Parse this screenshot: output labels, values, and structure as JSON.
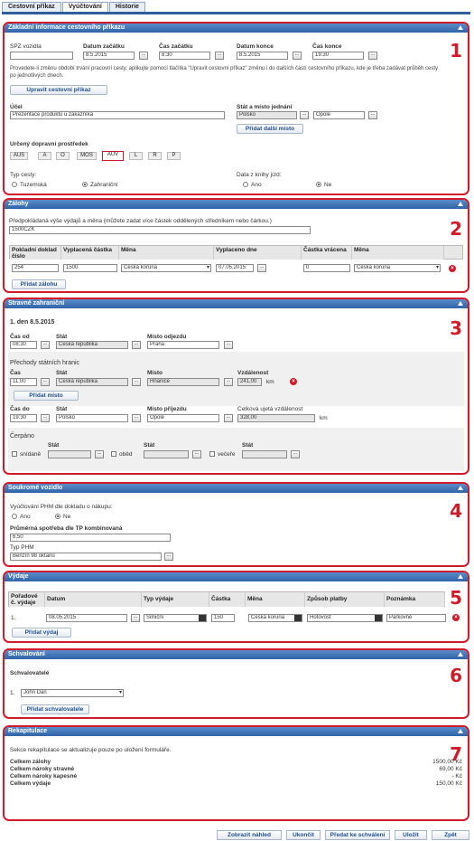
{
  "tabs": [
    "Cestovní příkaz",
    "Vyúčtování",
    "Historie"
  ],
  "s1": {
    "title": "Základní informace cestovního příkazu",
    "num": "1",
    "spz": "SPZ vozidla",
    "datum_zacatku": "Datum začátku",
    "cas_zacatku": "Čas začátku",
    "datum_konce": "Datum konce",
    "cas_konce": "Čas konce",
    "v_datum_zacatku": "8.5.2015",
    "v_cas_zacatku": "8:30",
    "v_datum_konce": "8.5.2015",
    "v_cas_konce": "19:30",
    "note": "Provedete-li změnu období trvání pracovní cesty, aplikujte pomocí tlačítka \"Upravit cestovní příkaz\" změnu i do dalších částí cestovního příkazu, kde je třeba zadávat průběh cesty po jednotlivých dnech.",
    "upravit": "Upravit cestovní příkaz",
    "ucel": "Účel",
    "v_ucel": "Prezentace produktu u zákazníka",
    "stat_misto": "Stát a místo jednání",
    "v_stat": "Polsko",
    "v_misto": "Opole",
    "pridat_misto": "Přidat další místo",
    "dopravni": "Určený dopravní prostředek",
    "transport": [
      "AUS",
      "A",
      "O",
      "MOS",
      "AUV",
      "L",
      "R",
      "P"
    ],
    "typ_cesty": "Typ cesty:",
    "tuzemska": "Tuzemská",
    "zahranicni": "Zahraniční",
    "data_kniha": "Data z knihy jízd:",
    "ano": "Ano",
    "ne": "Ne"
  },
  "s2": {
    "title": "Zálohy",
    "num": "2",
    "label": "Předpokládaná výše výdajů a měna (můžete zadat více částek oddělených středníkem nebo čárkou.)",
    "value": "1500CZK",
    "h_doklad": "Pokladní doklad číslo",
    "h_vyplacena": "Vyplacená částka",
    "h_mena": "Měna",
    "h_vyplaceno_dne": "Vyplaceno dne",
    "h_vracena": "Částka vrácena",
    "h_mena2": "Měna",
    "r_doklad": "254",
    "r_vyplacena": "1500",
    "r_mena": "Česká koruna",
    "r_dne": "07.05.2015",
    "r_vracena": "0",
    "r_mena2": "Česká koruna",
    "pridat": "Přidat zálohu"
  },
  "s3": {
    "title": "Stravné zahraniční",
    "num": "3",
    "day": "1. den  8.5.2015",
    "cas_od": "Čas od",
    "stat": "Stát",
    "misto_odjezdu": "Místo odjezdu",
    "v_cas_od": "08:30",
    "v_stat_od": "Česká republika",
    "v_misto_odjezdu": "Praha",
    "prechody": "Přechody státních hranic",
    "cas": "Čas",
    "misto": "Místo",
    "vzdalenost": "Vzdálenost",
    "v_cas_hr": "11:00",
    "v_stat_hr": "Česká republika",
    "v_misto_hr": "Hnanice",
    "v_vzdalenost": "241,00",
    "km": "km",
    "pridat_misto": "Přidat místo",
    "cas_do": "Čas do",
    "misto_prijezdu": "Místo příjezdu",
    "celkova": "Celková ujetá vzdálenost",
    "v_cas_do": "19:30",
    "v_stat_do": "Polsko",
    "v_misto_prijezdu": "Opole",
    "v_celkova": "328,00",
    "cerpano": "Čerpáno",
    "snidane": "snídaně",
    "obed": "oběd",
    "vecere": "večeře"
  },
  "s4": {
    "title": "Soukromé vozidlo",
    "num": "4",
    "vyuctovani": "Vyúčtování PHM dle dokladu o nákupu:",
    "ano": "Ano",
    "ne": "Ne",
    "spotreba": "Průměrná spotřeba dle TP kombinovaná",
    "v_spotreba": "6,50",
    "typ_phm": "Typ PHM",
    "v_typ_phm": "Benzín 98 oktanů"
  },
  "s5": {
    "title": "Výdaje",
    "num": "5",
    "h_poradove": "Pořadové č. výdaje",
    "h_datum": "Datum",
    "h_typ": "Typ výdaje",
    "h_castka": "Částka",
    "h_mena": "Měna",
    "h_zpusob": "Způsob platby",
    "h_poznamka": "Poznámka",
    "r_poradove": "1.",
    "r_datum": "08.05.2015",
    "r_typ": "Silniční",
    "r_castka": "150",
    "r_mena": "Česká koruna",
    "r_zpusob": "Hotovost",
    "r_poznamka": "Parkovné",
    "pridat": "Přidat výdaj"
  },
  "s6": {
    "title": "Schvalování",
    "num": "6",
    "schvalovatele": "Schvalovatelé",
    "idx": "1.",
    "v_schvalovatel": "John Dan",
    "pridat": "Přidat schvalovatele"
  },
  "s7": {
    "title": "Rekapitulace",
    "num": "7",
    "note": "Sekce rekapitulace se aktualizuje pouze po uložení formuláře.",
    "rows": [
      {
        "label": "Celkem zálohy",
        "value": "1500,00 Kč"
      },
      {
        "label": "Celkem nároky stravné",
        "value": "69,00 Kč"
      },
      {
        "label": "Celkem nároky kapesné",
        "value": "- Kč"
      },
      {
        "label": "Celkem výdaje",
        "value": "150,00 Kč"
      }
    ]
  },
  "footer": {
    "nahled": "Zobrazit náhled",
    "ukoncit": "Ukončit",
    "predat": "Předat ke schválení",
    "ulozit": "Uložit",
    "zpet": "Zpět"
  }
}
